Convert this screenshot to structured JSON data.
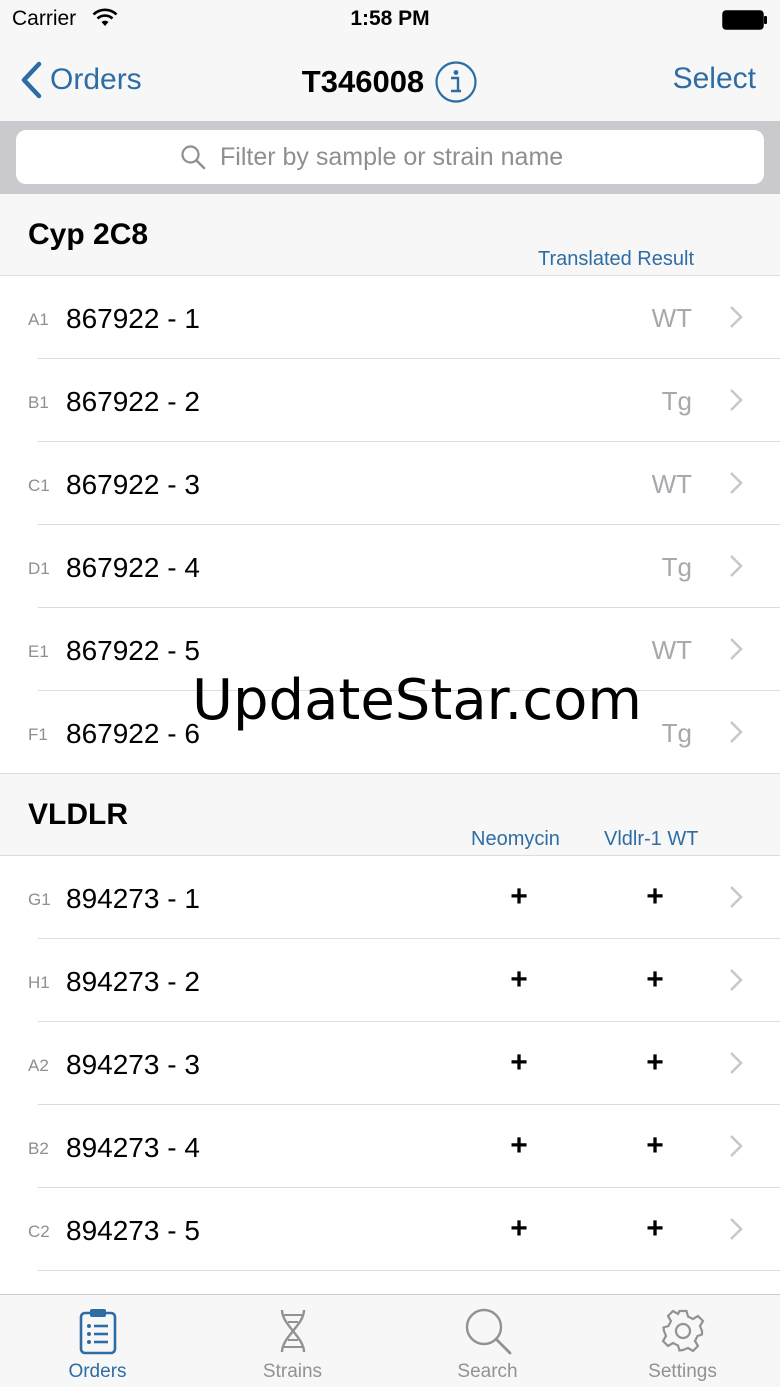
{
  "status_bar": {
    "carrier": "Carrier",
    "time": "1:58 PM"
  },
  "nav": {
    "back_label": "Orders",
    "title": "T346008",
    "select_label": "Select"
  },
  "search": {
    "placeholder": "Filter by sample or strain name"
  },
  "sections": [
    {
      "title": "Cyp 2C8",
      "columns": [
        "Translated Result"
      ],
      "rows": [
        {
          "well": "A1",
          "sample": "867922 - 1",
          "result": "WT"
        },
        {
          "well": "B1",
          "sample": "867922 - 2",
          "result": "Tg"
        },
        {
          "well": "C1",
          "sample": "867922 - 3",
          "result": "WT"
        },
        {
          "well": "D1",
          "sample": "867922 - 4",
          "result": "Tg"
        },
        {
          "well": "E1",
          "sample": "867922 - 5",
          "result": "WT"
        },
        {
          "well": "F1",
          "sample": "867922 - 6",
          "result": "Tg"
        }
      ]
    },
    {
      "title": "VLDLR",
      "columns": [
        "Neomycin",
        "Vldlr-1 WT"
      ],
      "rows": [
        {
          "well": "G1",
          "sample": "894273 - 1",
          "neomycin": "+",
          "vldlr": "+"
        },
        {
          "well": "H1",
          "sample": "894273 - 2",
          "neomycin": "+",
          "vldlr": "+"
        },
        {
          "well": "A2",
          "sample": "894273 - 3",
          "neomycin": "+",
          "vldlr": "+"
        },
        {
          "well": "B2",
          "sample": "894273 - 4",
          "neomycin": "+",
          "vldlr": "+"
        },
        {
          "well": "C2",
          "sample": "894273 - 5",
          "neomycin": "+",
          "vldlr": "+"
        }
      ]
    }
  ],
  "watermark": "UpdateStar.com",
  "tabs": [
    {
      "label": "Orders",
      "icon": "clipboard-icon",
      "active": true
    },
    {
      "label": "Strains",
      "icon": "dna-icon",
      "active": false
    },
    {
      "label": "Search",
      "icon": "magnifier-icon",
      "active": false
    },
    {
      "label": "Settings",
      "icon": "gear-icon",
      "active": false
    }
  ],
  "colors": {
    "accent": "#2e6da4",
    "inactive": "#929292",
    "secondary_text": "#a8a8ad"
  }
}
